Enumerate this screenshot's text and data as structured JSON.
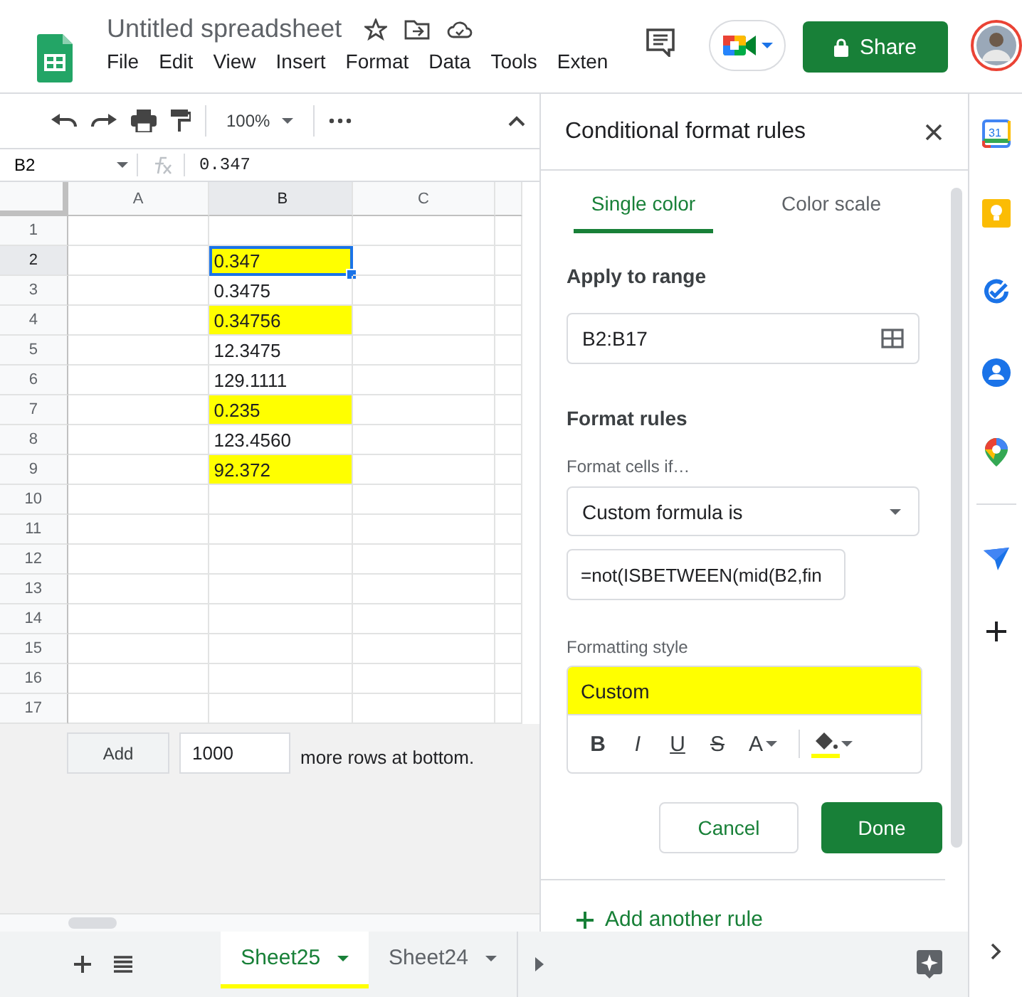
{
  "document": {
    "title": "Untitled spreadsheet",
    "menu": [
      "File",
      "Edit",
      "View",
      "Insert",
      "Format",
      "Data",
      "Tools",
      "Exten"
    ]
  },
  "share_button": "Share",
  "toolbar": {
    "zoom": "100%"
  },
  "formula_bar": {
    "cell": "B2",
    "value": "0.347"
  },
  "sheet": {
    "columns": [
      {
        "label": "A",
        "selected": false
      },
      {
        "label": "B",
        "selected": true
      },
      {
        "label": "C",
        "selected": false
      }
    ],
    "rows": [
      {
        "number": "1",
        "selected": false,
        "highlighted": false
      },
      {
        "number": "2",
        "value": "0.347",
        "selected": true,
        "highlighted": true
      },
      {
        "number": "3",
        "value": "0.3475",
        "selected": false,
        "highlighted": false
      },
      {
        "number": "4",
        "value": "0.34756",
        "selected": false,
        "highlighted": true
      },
      {
        "number": "5",
        "value": "12.3475",
        "selected": false,
        "highlighted": false
      },
      {
        "number": "6",
        "value": "129.1111",
        "selected": false,
        "highlighted": false
      },
      {
        "number": "7",
        "value": "0.235",
        "selected": false,
        "highlighted": true
      },
      {
        "number": "8",
        "value": "123.4560",
        "selected": false,
        "highlighted": false
      },
      {
        "number": "9",
        "value": "92.372",
        "selected": false,
        "highlighted": true
      },
      {
        "number": "10",
        "selected": false,
        "highlighted": false
      },
      {
        "number": "11",
        "selected": false,
        "highlighted": false
      },
      {
        "number": "12",
        "selected": false,
        "highlighted": false
      },
      {
        "number": "13",
        "selected": false,
        "highlighted": false
      },
      {
        "number": "14",
        "selected": false,
        "highlighted": false
      },
      {
        "number": "15",
        "selected": false,
        "highlighted": false
      },
      {
        "number": "16",
        "selected": false,
        "highlighted": false
      },
      {
        "number": "17",
        "selected": false,
        "highlighted": false
      }
    ],
    "add_rows": {
      "button": "Add",
      "count": "1000",
      "suffix": "more rows at bottom."
    }
  },
  "sheet_tabs": [
    {
      "label": "Sheet25",
      "selected": true
    },
    {
      "label": "Sheet24",
      "selected": false
    }
  ],
  "panel": {
    "title": "Conditional format rules",
    "tabs": [
      {
        "label": "Single color",
        "selected": true
      },
      {
        "label": "Color scale",
        "selected": false
      }
    ],
    "range_heading": "Apply to range",
    "range": "B2:B17",
    "rules_heading": "Format rules",
    "condition_label": "Format cells if…",
    "condition": "Custom formula is",
    "formula": "=not(ISBETWEEN(mid(B2,fin",
    "style_label": "Formatting style",
    "style_preview": "Custom",
    "style_buttons": [
      {
        "kind": "bold",
        "label": "B"
      },
      {
        "kind": "italic",
        "label": "I"
      },
      {
        "kind": "underline",
        "label": "U"
      },
      {
        "kind": "strike",
        "label": "S"
      },
      {
        "kind": "text_color",
        "label": "A"
      }
    ],
    "cancel_button": "Cancel",
    "done_button": "Done",
    "add_rule": "Add another rule"
  },
  "side_panel": {
    "calendar_day": "31"
  }
}
